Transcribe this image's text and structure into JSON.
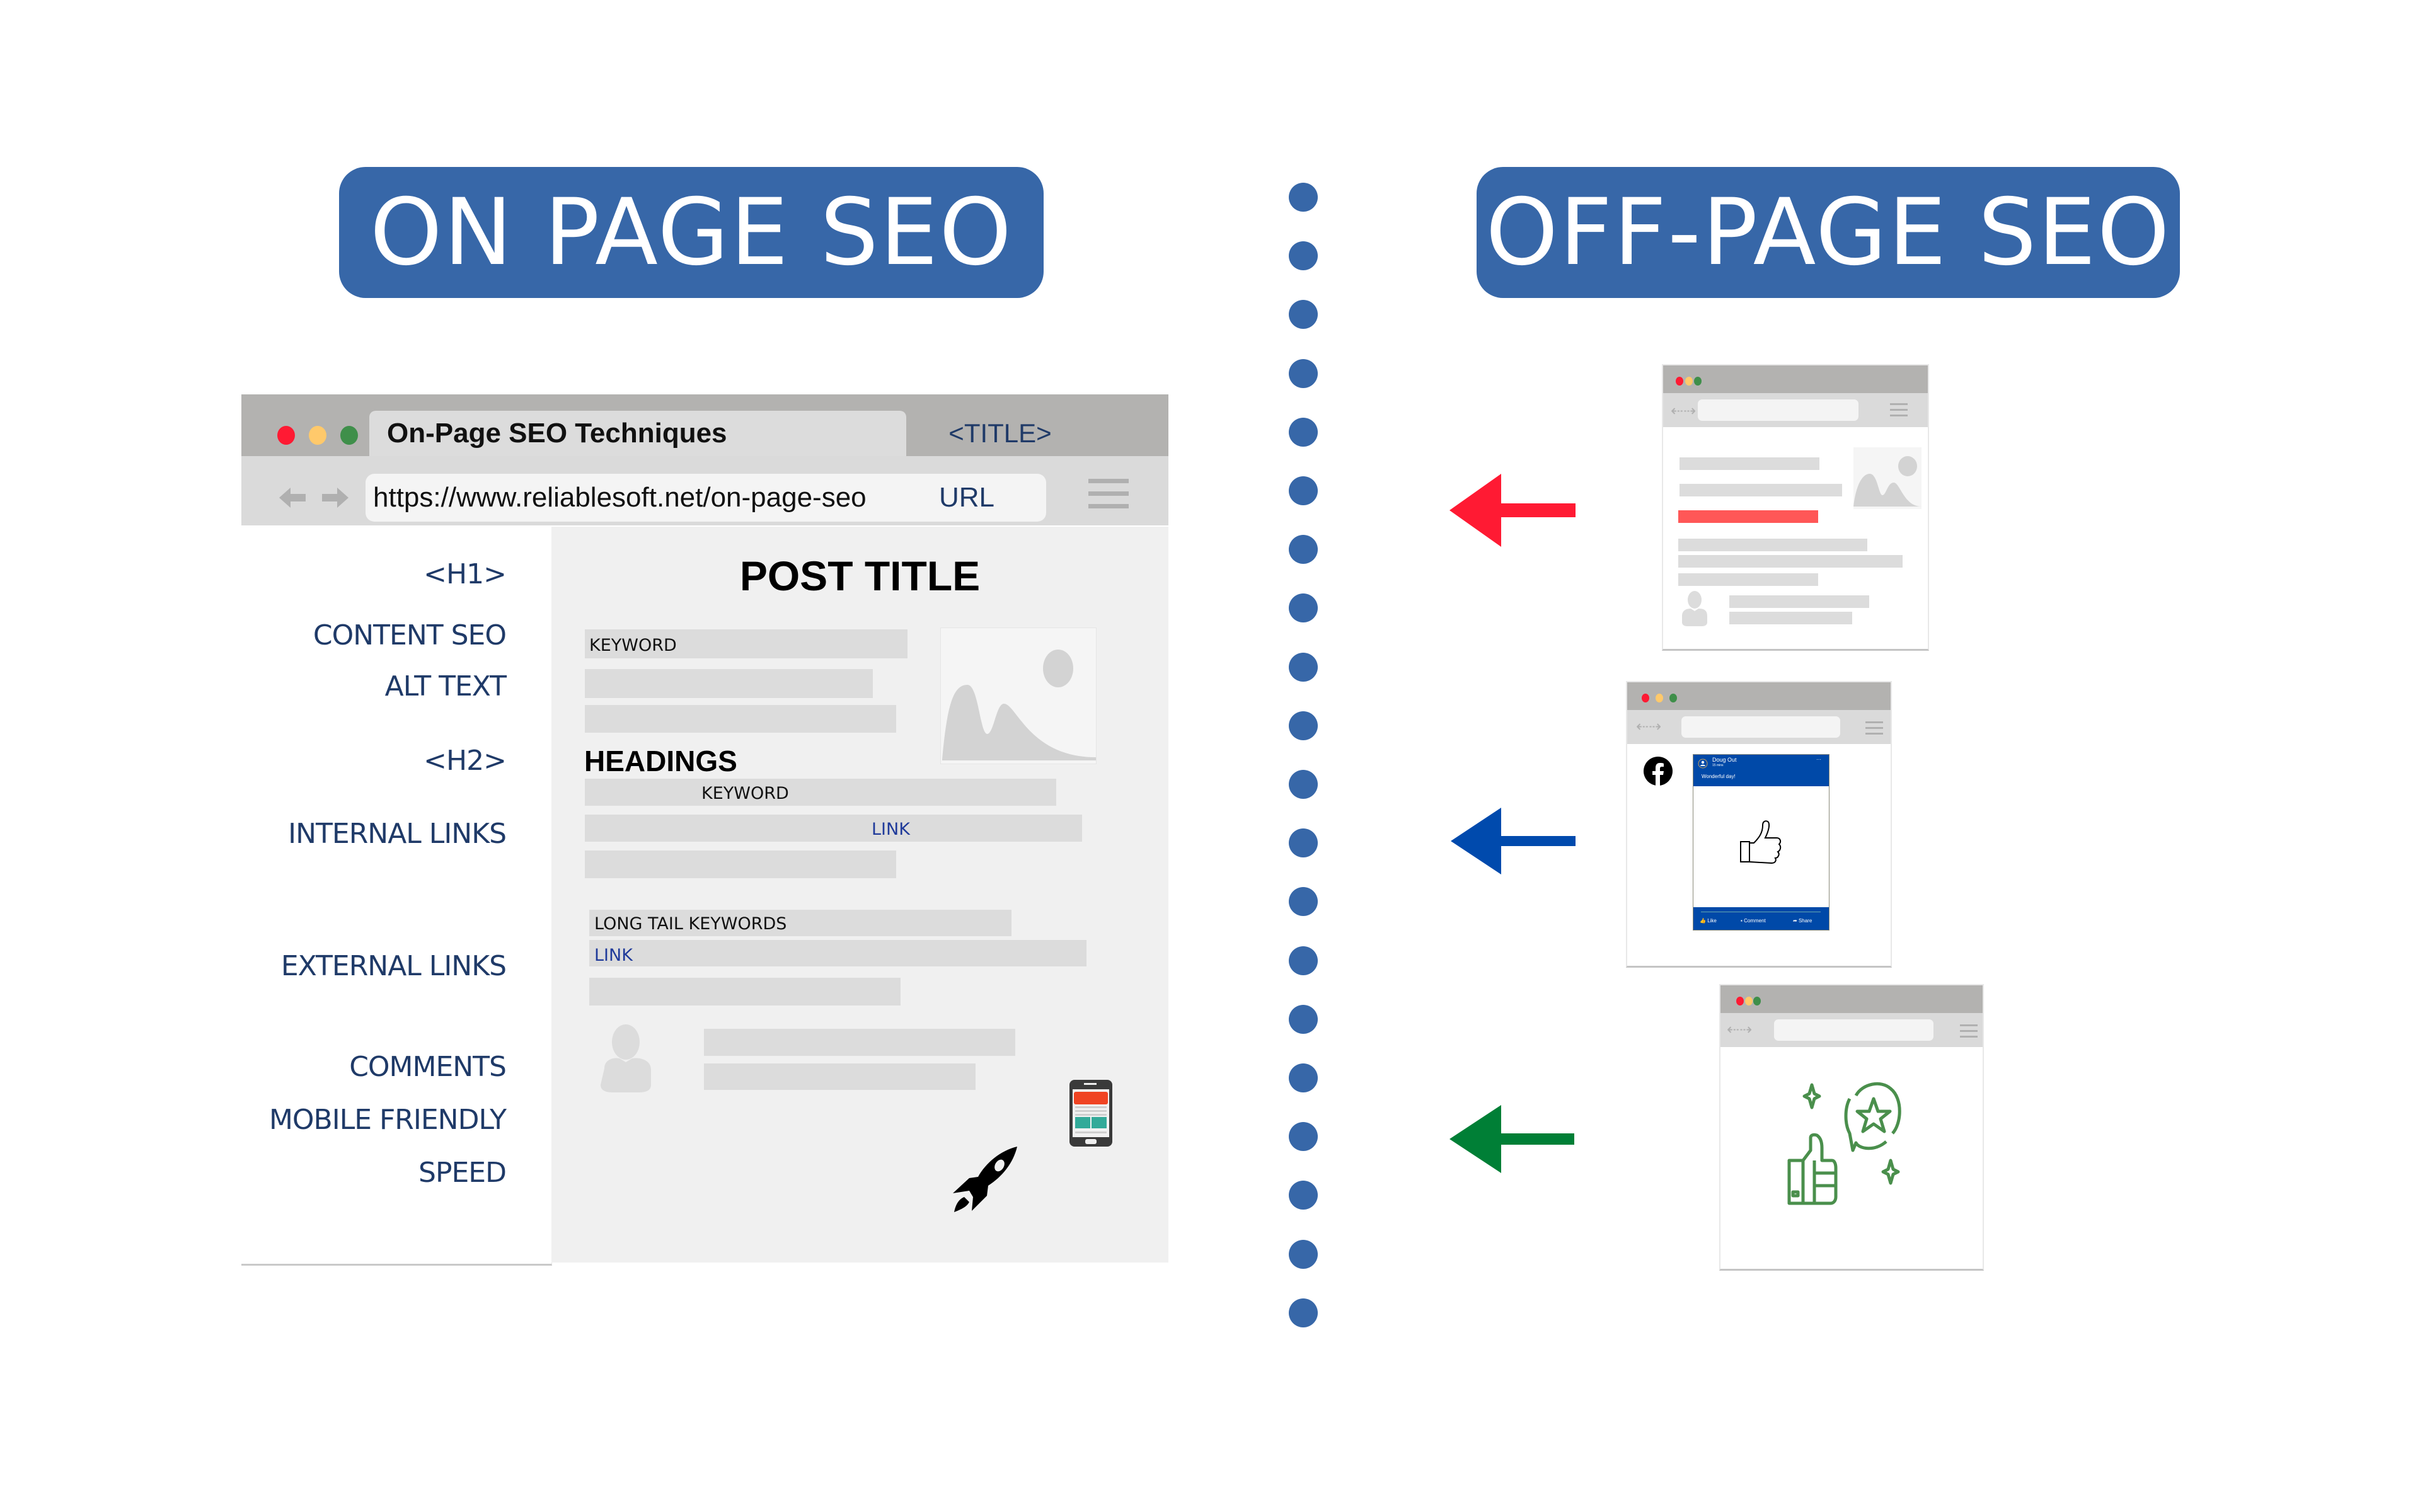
{
  "headers": {
    "on_page": "ON PAGE SEO",
    "off_page": "OFF-PAGE SEO"
  },
  "colors": {
    "header_bg": "#3767a8",
    "divider_dots": "#3767a8",
    "text_label": "#1f3a68",
    "arrow_red": "#ff1a33",
    "arrow_blue": "#004aad",
    "arrow_green": "#007f36",
    "traffic_red": "#ff1a33",
    "traffic_yellow": "#ffc96b",
    "traffic_green": "#3f8f4a",
    "highlight_bar": "#ff5757",
    "rating_icon": "#4a8f4c",
    "facebook_blue": "#0049a8"
  },
  "main_browser": {
    "tab_title": "On-Page SEO Techniques",
    "title_tag": "<TITLE>",
    "url": "https://www.reliablesoft.net/on-page-seo",
    "url_tag": "URL",
    "post_title": "POST TITLE",
    "headings_label": "HEADINGS",
    "sidebar_labels": [
      "<H1>",
      "CONTENT SEO",
      "ALT TEXT",
      "<H2>",
      "INTERNAL LINKS",
      "EXTERNAL LINKS",
      "COMMENTS",
      "MOBILE FRIENDLY",
      "SPEED"
    ],
    "bar_texts": {
      "keyword_1": "KEYWORD",
      "keyword_2": "KEYWORD",
      "internal_link": "LINK",
      "long_tail": "LONG TAIL KEYWORDS",
      "external_link": "LINK"
    }
  },
  "off_page": {
    "facebook_post": {
      "author": "Doug Out",
      "time": "15 mins",
      "message": "Wonderful day!",
      "actions": [
        "Like",
        "Comment",
        "Share"
      ]
    }
  }
}
